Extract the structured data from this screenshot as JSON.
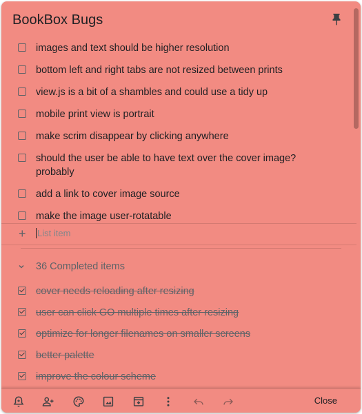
{
  "note": {
    "title": "BookBox Bugs",
    "items": [
      {
        "text": "images and text should be higher resolution"
      },
      {
        "text": "bottom left and right tabs are not resized between prints"
      },
      {
        "text": "view.js is a bit of a shambles and could use a tidy up"
      },
      {
        "text": "mobile print view is portrait"
      },
      {
        "text": "make scrim disappear by clicking anywhere"
      },
      {
        "text": "should the user be able to have text over the cover image? probably"
      },
      {
        "text": "add a link to cover image source"
      },
      {
        "text": "make the image user-rotatable"
      }
    ],
    "new_item_placeholder": "List item",
    "completed_label": "36 Completed items",
    "completed_items": [
      {
        "text": "cover needs reloading after resizing"
      },
      {
        "text": "user can click GO multiple times after resizing"
      },
      {
        "text": "optimize for longer filenames on smaller screens"
      },
      {
        "text": "better palette"
      },
      {
        "text": "improve the colour scheme"
      }
    ]
  },
  "toolbar": {
    "close_label": "Close",
    "icons": [
      "reminder-icon",
      "collaborator-icon",
      "palette-icon",
      "image-icon",
      "archive-icon",
      "more-icon",
      "undo-icon",
      "redo-icon"
    ]
  },
  "colors": {
    "card_background": "#f28b82",
    "text": "#202124",
    "muted": "#5f6368"
  }
}
